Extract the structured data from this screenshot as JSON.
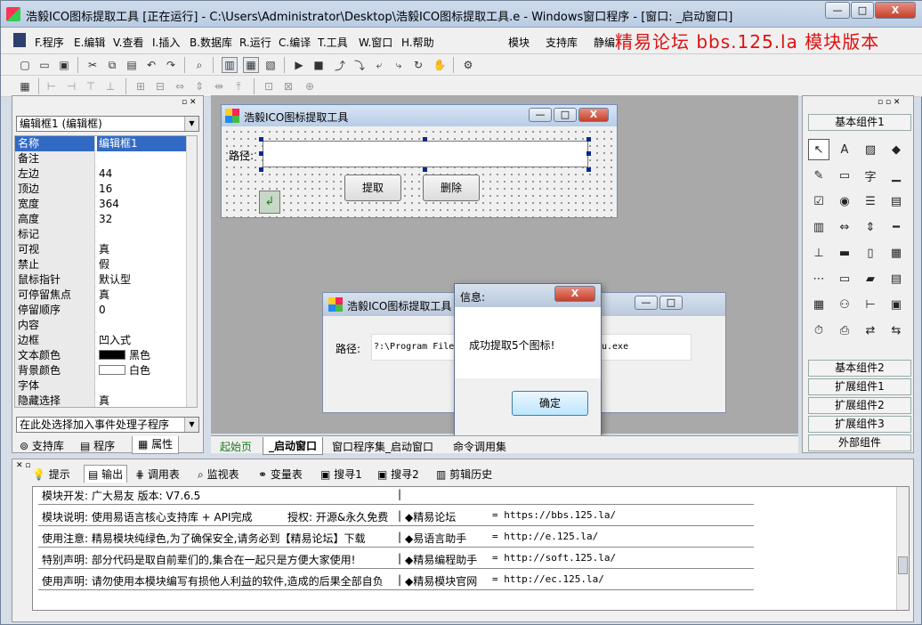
{
  "window": {
    "title": "浩毅ICO图标提取工具 [正在运行] - C:\\Users\\Administrator\\Desktop\\浩毅ICO图标提取工具.e - Windows窗口程序 - [窗口: _启动窗口]",
    "min": "—",
    "max": "□",
    "close": "X"
  },
  "watermark": "精易论坛 bbs.125.la 模块版本",
  "menu": [
    "F.程序",
    "E.编辑",
    "V.查看",
    "I.插入",
    "B.数据库",
    "R.运行",
    "C.编译",
    "T.工具",
    "W.窗口",
    "H.帮助",
    "模块",
    "支持库",
    "静编"
  ],
  "toolbar_icons": [
    "new-icon",
    "open-icon",
    "save-icon",
    "cut-icon",
    "copy-icon",
    "paste-icon",
    "undo-icon",
    "redo-icon",
    "find-icon",
    "layout1-icon",
    "layout2-icon",
    "layout3-icon",
    "run-icon",
    "stop-icon",
    "step-icon",
    "step-into-icon",
    "step-out-icon",
    "breakpoint-icon",
    "watch-icon",
    "hand-icon",
    "debug-icon"
  ],
  "props": {
    "selector": "编辑框1 (编辑框)",
    "rows": [
      {
        "k": "名称",
        "v": "编辑框1"
      },
      {
        "k": "备注",
        "v": ""
      },
      {
        "k": "左边",
        "v": "44"
      },
      {
        "k": "顶边",
        "v": "16"
      },
      {
        "k": "宽度",
        "v": "364"
      },
      {
        "k": "高度",
        "v": "32"
      },
      {
        "k": "标记",
        "v": ""
      },
      {
        "k": "可视",
        "v": "真"
      },
      {
        "k": "禁止",
        "v": "假"
      },
      {
        "k": "鼠标指针",
        "v": "默认型"
      },
      {
        "k": "可停留焦点",
        "v": "真"
      },
      {
        "k": "停留顺序",
        "v": "0"
      },
      {
        "k": "内容",
        "v": ""
      },
      {
        "k": "边框",
        "v": "凹入式"
      },
      {
        "k": "文本颜色",
        "v": "黑色"
      },
      {
        "k": "背景颜色",
        "v": "白色"
      },
      {
        "k": "字体",
        "v": ""
      },
      {
        "k": "隐藏选择",
        "v": "真"
      }
    ],
    "event_hint": "在此处选择加入事件处理子程序",
    "tabs": [
      "支持库",
      "程序",
      "属性"
    ]
  },
  "designer": {
    "form_title": "浩毅ICO图标提取工具",
    "path_label": "路径:",
    "extract_btn": "提取",
    "delete_btn": "删除"
  },
  "runtime": {
    "form_title": "浩毅ICO图标提取工具",
    "path_label": "路径:",
    "path_value": "?:\\Program Files",
    "path_tail": "u.exe"
  },
  "dialog": {
    "title": "信息:",
    "message": "成功提取5个图标!",
    "ok": "确定",
    "close": "X"
  },
  "doc_tabs": [
    "起始页",
    "_启动窗口",
    "窗口程序集_启动窗口",
    "命令调用集"
  ],
  "components": {
    "groups_top": [
      "基本组件1"
    ],
    "groups_bottom": [
      "基本组件2",
      "扩展组件1",
      "扩展组件2",
      "扩展组件3",
      "外部组件"
    ]
  },
  "bottom_tabs": [
    "提示",
    "输出",
    "调用表",
    "监视表",
    "变量表",
    "搜寻1",
    "搜寻2",
    "剪辑历史"
  ],
  "output_rows": [
    {
      "a": "模块开发: 广大易友    版本: V7.6.5",
      "b": "",
      "c": "",
      "d": ""
    },
    {
      "a": "模块说明: 使用易语言核心支持库 + API完成",
      "b": "授权: 开源&永久免费",
      "c": "◆精易论坛",
      "d": "=  https://bbs.125.la/"
    },
    {
      "a": "使用注意: 精易模块纯绿色,为了确保安全,请务必到【精易论坛】下载",
      "b": "",
      "c": "◆易语言助手",
      "d": "=  http://e.125.la/"
    },
    {
      "a": "特别声明: 部分代码是取自前辈们的,集合在一起只是方便大家使用!",
      "b": "",
      "c": "◆精易编程助手",
      "d": "=  http://soft.125.la/"
    },
    {
      "a": "使用声明: 请勿使用本模块编写有损他人利益的软件,造成的后果全部自负",
      "b": "",
      "c": "◆精易模块官网",
      "d": "=  http://ec.125.la/"
    }
  ]
}
